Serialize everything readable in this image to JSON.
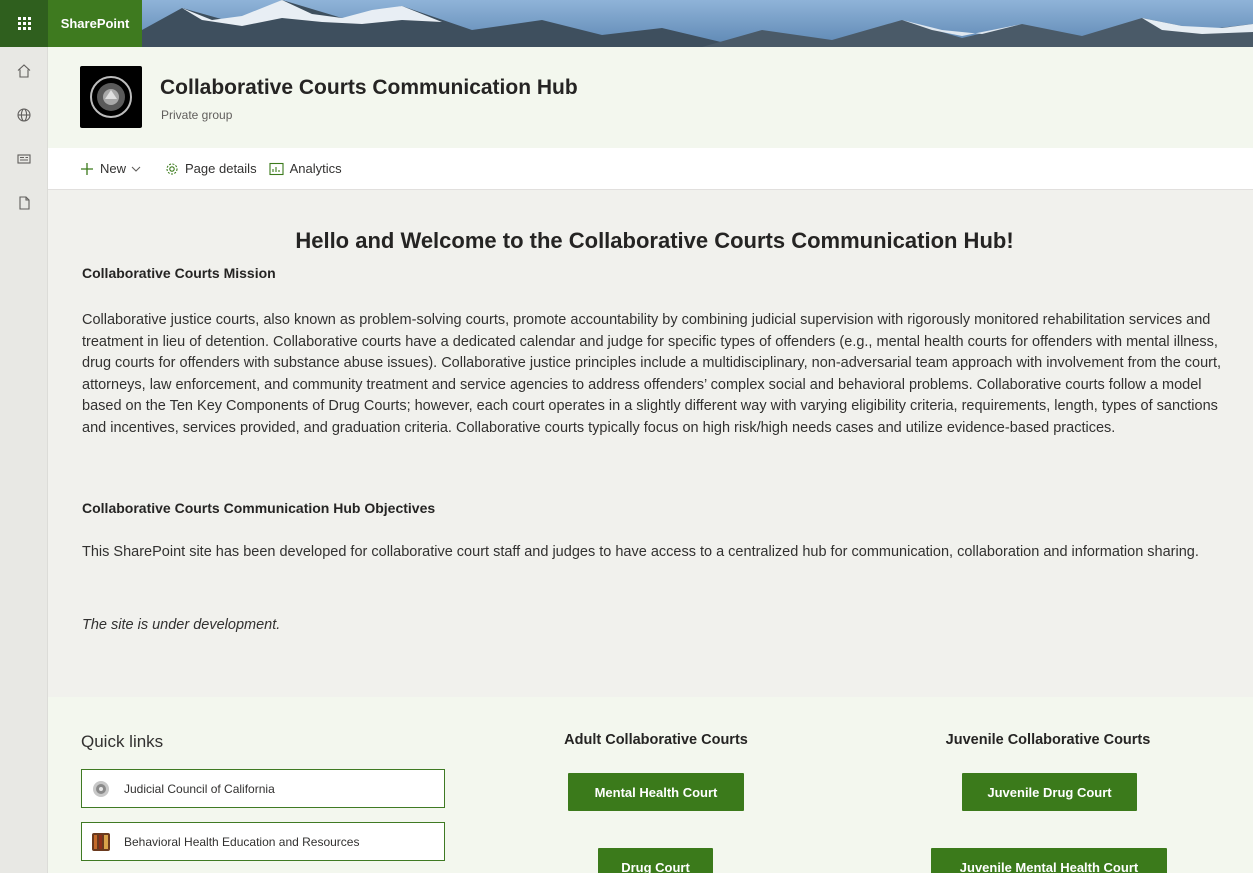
{
  "suite": {
    "brand": "SharePoint"
  },
  "site": {
    "title": "Collaborative Courts Communication Hub",
    "subtitle": "Private group"
  },
  "commands": {
    "new_label": "New",
    "page_details_label": "Page details",
    "analytics_label": "Analytics"
  },
  "content": {
    "welcome_title": "Hello and Welcome to the Collaborative Courts Communication Hub!",
    "mission_heading": "Collaborative Courts Mission",
    "mission_text": "Collaborative justice courts, also known as problem-solving courts, promote accountability by combining judicial supervision with rigorously monitored rehabilitation services and treatment in lieu of detention. Collaborative courts have a dedicated calendar and judge for specific types of offenders (e.g., mental health courts for offenders with mental illness, drug courts for offenders with substance abuse issues). Collaborative justice principles include a multidisciplinary, non-adversarial team approach with involvement from the court, attorneys, law enforcement, and community treatment and service agencies to address offenders’ complex social and behavioral problems. Collaborative courts follow a model based on the Ten Key Components of Drug Courts; however, each court operates in a slightly different way with varying eligibility criteria, requirements, length, types of sanctions and incentives, services provided, and graduation criteria. Collaborative courts typically focus on high risk/high needs cases and utilize evidence-based practices.",
    "objectives_heading": "Collaborative Courts Communication Hub Objectives",
    "objectives_text": "This SharePoint site has been developed for collaborative court staff and judges to have access to a centralized hub for communication, collaboration and information sharing.",
    "dev_note": "The site is under development."
  },
  "quick_links": {
    "title": "Quick links",
    "items": [
      {
        "label": "Judicial Council of California"
      },
      {
        "label": "Behavioral Health Education and Resources"
      }
    ]
  },
  "adult": {
    "heading": "Adult Collaborative Courts",
    "buttons": [
      "Mental Health Court",
      "Drug Court"
    ]
  },
  "juvenile": {
    "heading": "Juvenile Collaborative Courts",
    "buttons": [
      "Juvenile Drug Court",
      "Juvenile Mental Health Court"
    ]
  },
  "colors": {
    "brand_green": "#3e7a1f",
    "button_green": "#3b7a1b",
    "header_bg": "#f3f7ee",
    "content_bg": "#f1f1ed"
  },
  "icons": {
    "waffle": "app-launcher-icon",
    "rail": [
      "home-icon",
      "globe-icon",
      "news-icon",
      "document-icon"
    ],
    "new": "plus-icon",
    "page_details": "gear-icon",
    "analytics": "analytics-icon"
  }
}
